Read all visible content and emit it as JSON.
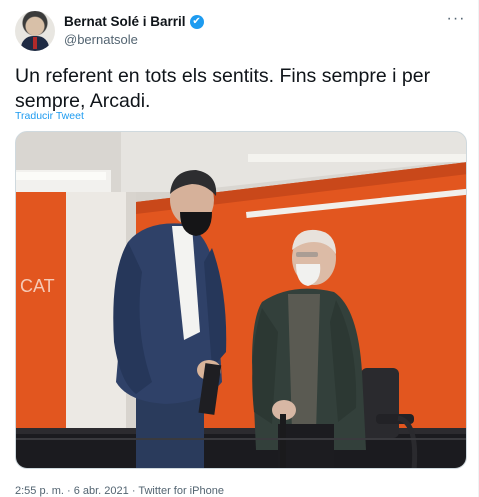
{
  "author": {
    "display_name": "Bernat Solé i Barril",
    "handle": "@bernatsole",
    "verified_mark": "✔"
  },
  "menu": {
    "more_icon": "more-horizontal-icon",
    "more_glyph": "···"
  },
  "tweet": {
    "text": "Un referent en tots els sentits. Fins sempre i per sempre, Arcadi.",
    "translate_label": "Traducir Tweet",
    "time": "2:55 p. m.",
    "separator": " · ",
    "date": "6 abr. 2021",
    "source": "Twitter for iPhone"
  },
  "media": {
    "wall_sign_text": "CAT"
  },
  "colors": {
    "accent": "#1d9bf0",
    "text_secondary": "#536471",
    "wall_orange": "#e2561f"
  }
}
